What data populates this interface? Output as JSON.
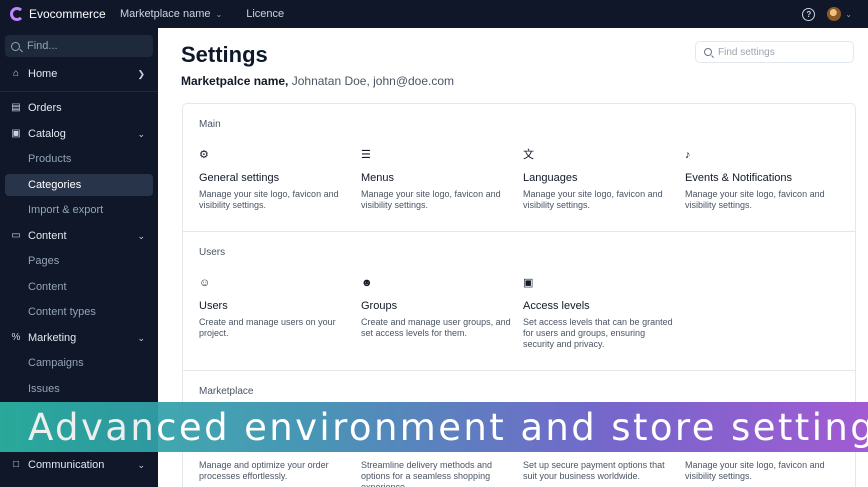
{
  "topbar": {
    "brand": "Evocommerce",
    "marketplace_link": "Marketplace name",
    "licence_link": "Licence"
  },
  "sidebar": {
    "search_placeholder": "Find...",
    "home": "Home",
    "orders": "Orders",
    "catalog": "Catalog",
    "catalog_items": [
      "Products",
      "Categories",
      "Import & export"
    ],
    "content": "Content",
    "content_items": [
      "Pages",
      "Content",
      "Content types"
    ],
    "marketing": "Marketing",
    "marketing_items": [
      "Campaigns",
      "Issues"
    ],
    "communication": "Communication"
  },
  "main": {
    "title": "Settings",
    "subtitle_strong": "Marketpalce name,",
    "subtitle_muted": "Johnatan Doe, john@doe.com",
    "find_placeholder": "Find settings",
    "sections": [
      {
        "title": "Main",
        "cards": [
          {
            "icon": "gear-icon",
            "title": "General settings",
            "desc": "Manage your site logo, favicon and visibility settings."
          },
          {
            "icon": "menu-icon",
            "title": "Menus",
            "desc": "Manage your site logo, favicon and visibility settings."
          },
          {
            "icon": "translate-icon",
            "title": "Languages",
            "desc": "Manage your site logo, favicon and visibility settings."
          },
          {
            "icon": "bell-icon",
            "title": "Events & Notifications",
            "desc": "Manage your site logo, favicon and visibility settings."
          }
        ]
      },
      {
        "title": "Users",
        "cards": [
          {
            "icon": "user-icon",
            "title": "Users",
            "desc": "Create and manage users on your project."
          },
          {
            "icon": "users-icon",
            "title": "Groups",
            "desc": "Create and manage user groups, and set access levels for them."
          },
          {
            "icon": "lock-icon",
            "title": "Access levels",
            "desc": "Set access levels that can be granted for users and groups, ensuring security and privacy."
          }
        ]
      },
      {
        "title": "Marketplace",
        "cards": [
          {
            "desc": "Manage and optimize your order processes effortlessly."
          },
          {
            "desc": "Streamline delivery methods and options for a seamless shopping experience."
          },
          {
            "desc": "Set up secure payment options that suit your business worldwide."
          },
          {
            "desc": "Manage your site logo, favicon and visibility settings."
          }
        ]
      }
    ]
  },
  "banner": {
    "text": "Advanced environment and store settings"
  },
  "colors": {
    "sidebar_bg": "#0f1729",
    "active_item_bg": "#273449",
    "brand_accent": "#c084fc",
    "banner_start": "#2bb5a3",
    "banner_end": "#9b4fd0"
  }
}
